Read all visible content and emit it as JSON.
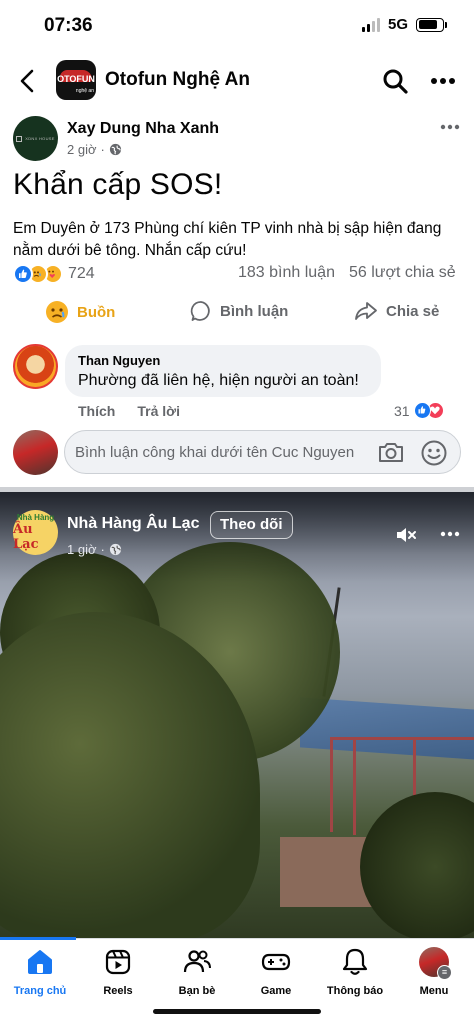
{
  "status_bar": {
    "time": "07:36",
    "network": "5G"
  },
  "group": {
    "name": "Otofun Nghệ An",
    "logo_text": "OTOFUN",
    "logo_sub": "nghệ an"
  },
  "post": {
    "author": "Xay Dung Nha Xanh",
    "avatar_text": "XDNX HOUSE",
    "time": "2 giờ",
    "title": "Khẩn cấp SOS!",
    "body": "Em Duyên ở 173 Phùng chí kiên TP vinh nhà bị sập hiện đang nằm dưới bê tông. Nhắn cấp cứu!",
    "reaction_count": "724",
    "comment_count": "183 bình luận",
    "share_count": "56 lượt chia sẻ",
    "actions": {
      "react": "Buồn",
      "comment": "Bình luận",
      "share": "Chia sẻ"
    }
  },
  "comment": {
    "name": "Than Nguyen",
    "text": "Phường đã liên hệ, hiện người an toàn!",
    "like": "Thích",
    "reply": "Trả lời",
    "reaction_count": "31"
  },
  "composer": {
    "placeholder": "Bình luận công khai dưới tên Cuc Nguyen"
  },
  "video_post": {
    "author": "Nhà Hàng Âu Lạc",
    "avatar_line1": "Nhà Hàng",
    "avatar_line2": "Âu Lạc",
    "follow": "Theo dõi",
    "time": "1 giờ"
  },
  "nav": {
    "items": [
      {
        "label": "Trang chủ",
        "icon": "home-icon",
        "active": true
      },
      {
        "label": "Reels",
        "icon": "reels-icon"
      },
      {
        "label": "Bạn bè",
        "icon": "friends-icon"
      },
      {
        "label": "Game",
        "icon": "gamepad-icon"
      },
      {
        "label": "Thông báo",
        "icon": "bell-icon"
      },
      {
        "label": "Menu",
        "icon": "menu-avatar"
      }
    ]
  },
  "colors": {
    "accent": "#1877f2",
    "sad": "#e8a317",
    "love": "#f33e58",
    "muted": "#65676b"
  }
}
